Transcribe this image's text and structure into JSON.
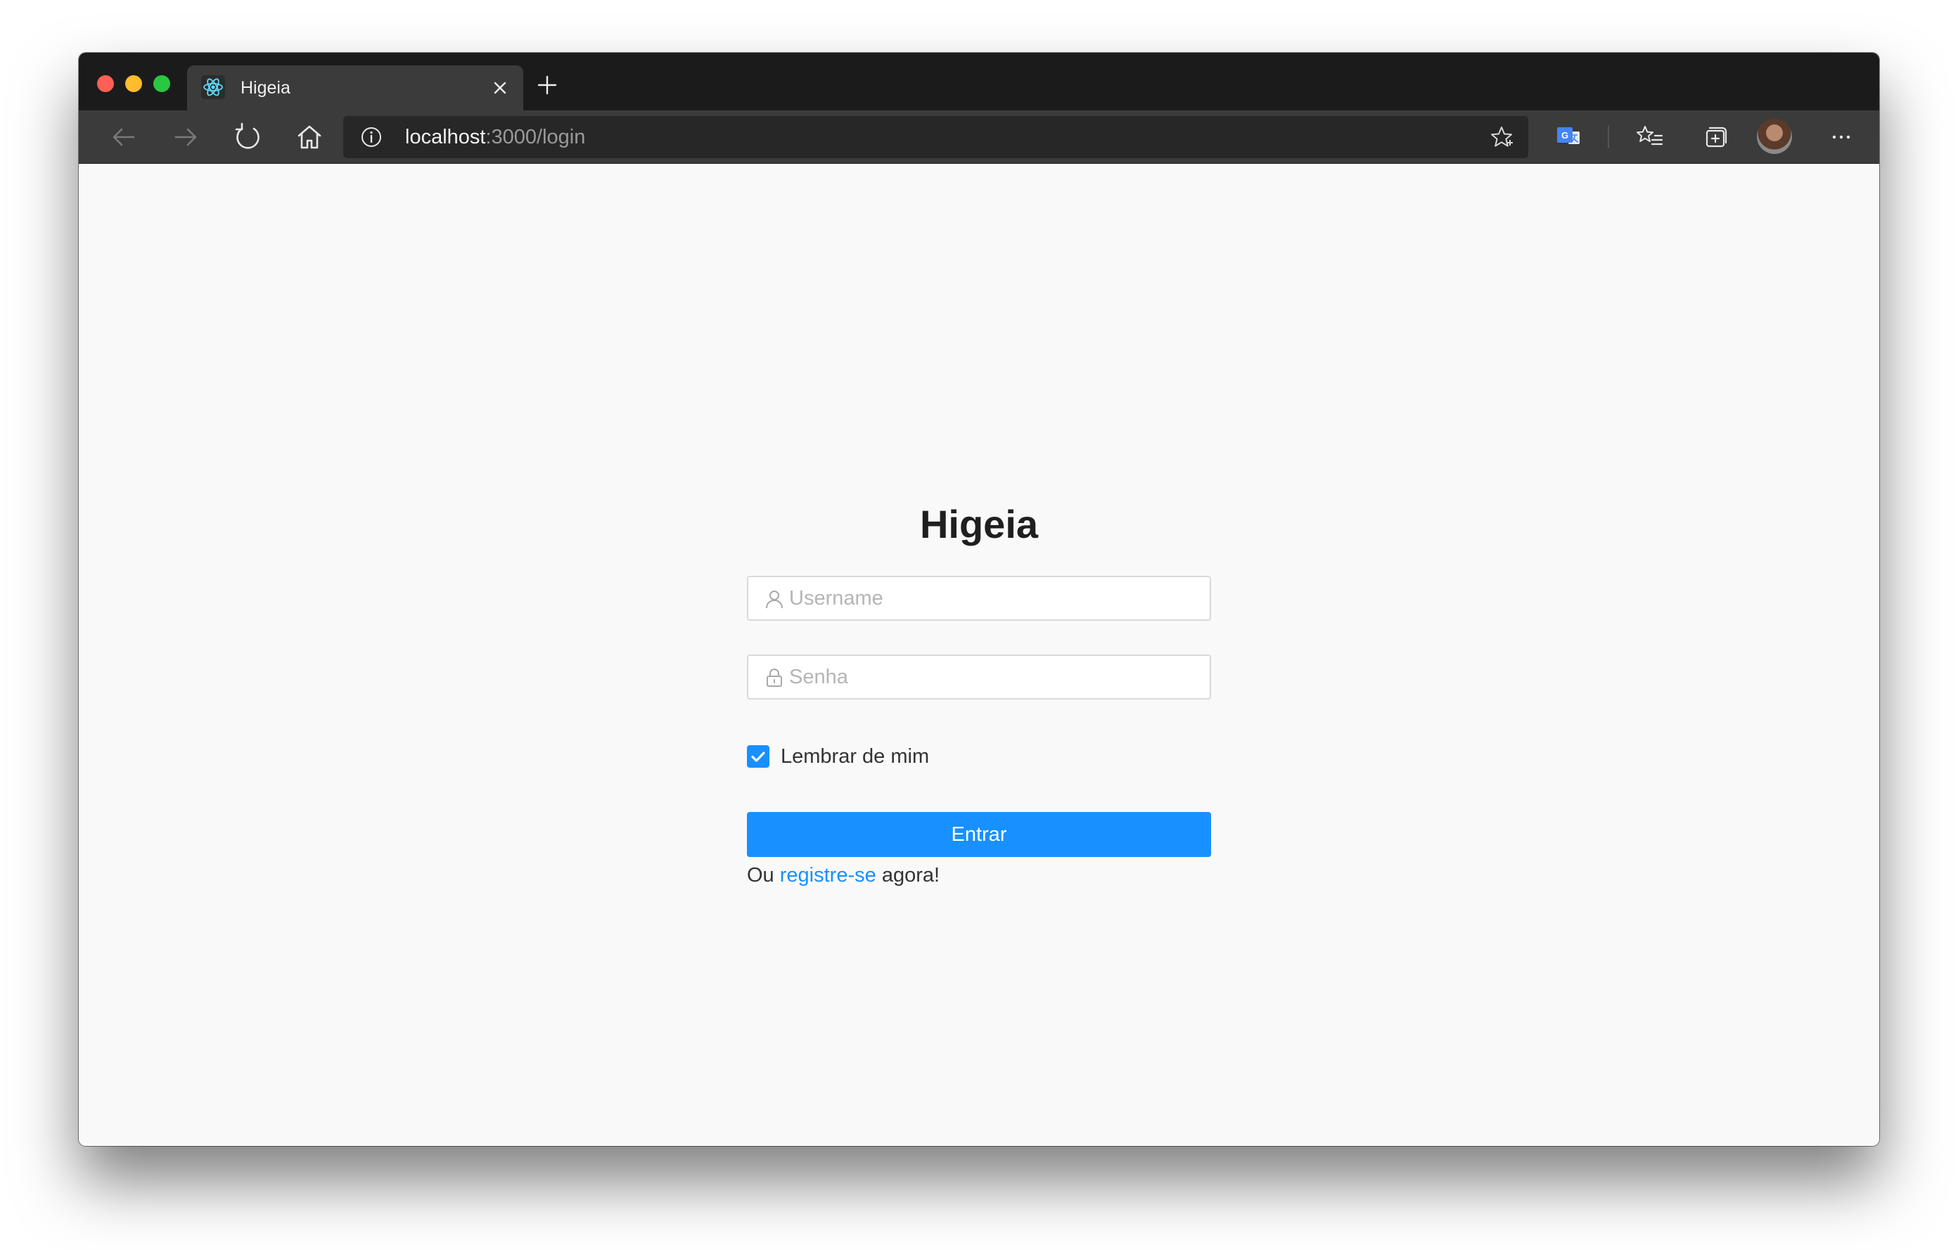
{
  "browser": {
    "tab": {
      "title": "Higeia",
      "favicon": "react-icon"
    },
    "address": {
      "host": "localhost",
      "path": ":3000/login"
    },
    "icons": {
      "back": "back-arrow-icon",
      "forward": "forward-arrow-icon",
      "reload": "reload-icon",
      "home": "home-icon",
      "info": "info-icon",
      "favorite": "star-icon",
      "translate": "translate-icon",
      "favorites": "favorites-icon",
      "collections": "collections-icon",
      "more": "more-icon"
    }
  },
  "login": {
    "title": "Higeia",
    "username_placeholder": "Username",
    "password_placeholder": "Senha",
    "remember_label": "Lembrar de mim",
    "remember_checked": true,
    "submit_label": "Entrar",
    "register_prefix": "Ou",
    "register_link": "registre-se",
    "register_suffix": "agora!"
  },
  "colors": {
    "accent": "#1890ff",
    "titlebar": "#1b1b1b",
    "toolbar": "#3b3b3b",
    "page_bg": "#f9f9f9"
  }
}
